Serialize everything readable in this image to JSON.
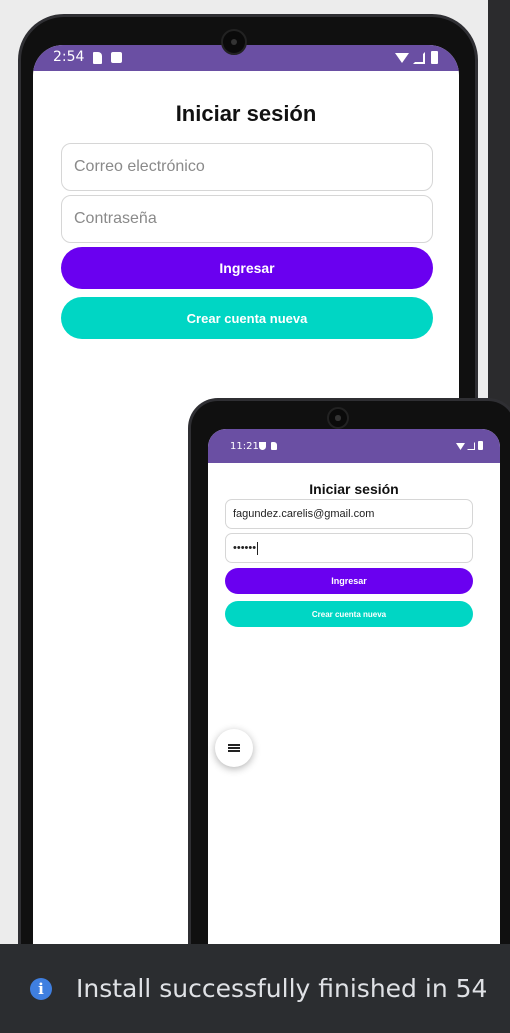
{
  "back_phone": {
    "status_time": "2:54",
    "title": "Iniciar sesión",
    "email_placeholder": "Correo electrónico",
    "password_placeholder": "Contraseña",
    "login_label": "Ingresar",
    "create_account_label": "Crear cuenta nueva"
  },
  "front_phone": {
    "status_time": "11:21",
    "title": "Iniciar sesión",
    "email_value": "fagundez.carelis@gmail.com",
    "password_value": "••••••",
    "login_label": "Ingresar",
    "create_account_label": "Crear cuenta nueva"
  },
  "notification": {
    "message": "Install successfully finished in 54"
  },
  "icons": {
    "sd_card": "sd-card-icon",
    "wifi": "wifi-icon",
    "signal": "signal-icon",
    "battery": "battery-icon",
    "menu": "menu-icon",
    "info": "info-icon"
  },
  "colors": {
    "status_bar": "#6a4fa3",
    "primary_button": "#6a00f0",
    "secondary_button": "#00d6c4",
    "notification_bg": "#2b2d30"
  }
}
